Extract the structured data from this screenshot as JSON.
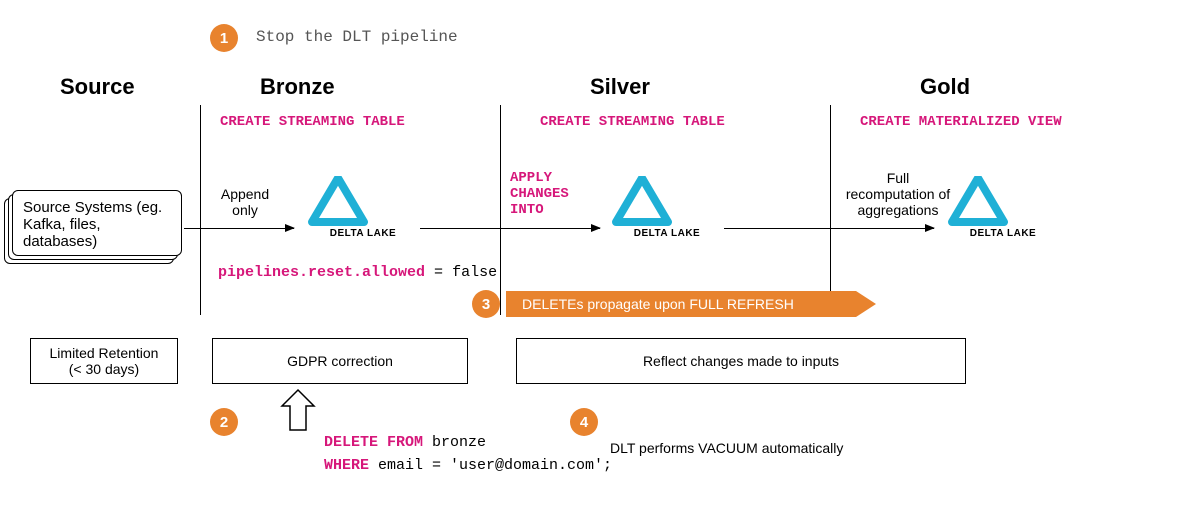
{
  "steps": {
    "step1_num": "1",
    "step1_text": "Stop the DLT pipeline",
    "step2_num": "2",
    "step3_num": "3",
    "step3_text": "DELETEs propagate upon FULL REFRESH",
    "step4_num": "4",
    "step4_text": "DLT performs VACUUM automatically"
  },
  "columns": {
    "source": "Source",
    "bronze": "Bronze",
    "silver": "Silver",
    "gold": "Gold"
  },
  "subheaders": {
    "bronze": "CREATE STREAMING TABLE",
    "silver": "CREATE STREAMING TABLE",
    "gold": "CREATE MATERIALIZED VIEW"
  },
  "source_box": "Source Systems (eg. Kafka, files, databases)",
  "arrow_labels": {
    "append_only": "Append\nonly",
    "apply_changes": "APPLY\nCHANGES\nINTO",
    "gold": "Full\nrecomputation of\naggregations"
  },
  "delta_brand": "DELTA LAKE",
  "config_line": {
    "key": "pipelines.reset.allowed",
    "op": " = ",
    "val": "false"
  },
  "bottom_boxes": {
    "source": "Limited Retention\n(< 30 days)",
    "bronze": "GDPR correction",
    "silver_gold": "Reflect changes made to inputs"
  },
  "delete_stmt": {
    "kw1": "DELETE FROM",
    "tbl": " bronze",
    "kw2": "WHERE",
    "rest": " email = 'user@domain.com';"
  }
}
